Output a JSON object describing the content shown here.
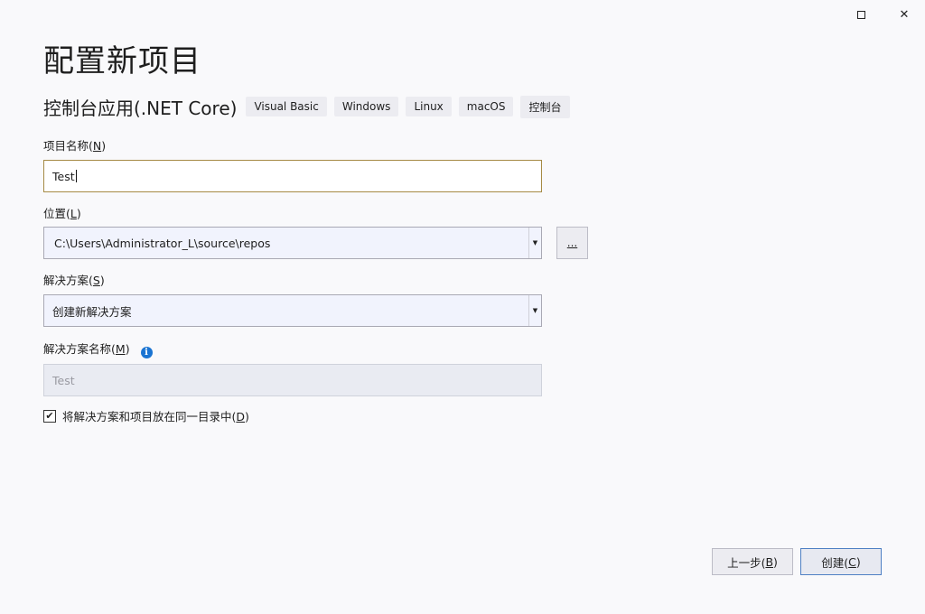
{
  "window": {
    "maximize_icon": "maximize-icon",
    "close_icon": "close-icon",
    "close_glyph": "✕"
  },
  "header": {
    "title": "配置新项目",
    "template_name": "控制台应用(.NET Core)",
    "tags": [
      "Visual Basic",
      "Windows",
      "Linux",
      "macOS",
      "控制台"
    ]
  },
  "form": {
    "project_name": {
      "label": "项目名称(",
      "accel": "N",
      "label_end": ")",
      "value": "Test"
    },
    "location": {
      "label": "位置(",
      "accel": "L",
      "label_end": ")",
      "value": "C:\\Users\\Administrator_L\\source\\repos",
      "browse_label": "..."
    },
    "solution": {
      "label": "解决方案(",
      "accel": "S",
      "label_end": ")",
      "value": "创建新解决方案"
    },
    "solution_name": {
      "label": "解决方案名称(",
      "accel": "M",
      "label_end": ")",
      "placeholder": "Test",
      "info_glyph": "i"
    },
    "same_dir": {
      "label": "将解决方案和项目放在同一目录中(",
      "accel": "D",
      "label_end": ")",
      "checked": true,
      "check_glyph": "✔"
    }
  },
  "footer": {
    "back": {
      "label": "上一步(",
      "accel": "B",
      "label_end": ")"
    },
    "create": {
      "label": "创建(",
      "accel": "C",
      "label_end": ")"
    }
  },
  "colors": {
    "accent": "#4f80c4",
    "focus_border": "#a58a44",
    "info_blue": "#1a74d2"
  }
}
